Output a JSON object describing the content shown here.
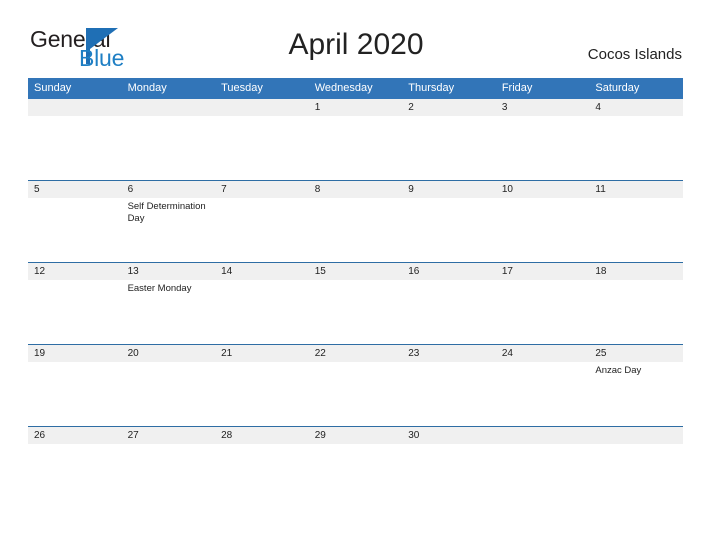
{
  "brand": {
    "name_part1": "General",
    "name_part2": "Blue",
    "accent_color": "#1f7fc4"
  },
  "header": {
    "title": "April 2020",
    "locale": "Cocos Islands"
  },
  "calendar": {
    "header_bg": "#3275b8",
    "daynum_band_bg": "#f0f0f0",
    "row_divider_color": "#2e6da4",
    "weekday_headers": [
      "Sunday",
      "Monday",
      "Tuesday",
      "Wednesday",
      "Thursday",
      "Friday",
      "Saturday"
    ],
    "weeks": [
      [
        {
          "day": "",
          "events": []
        },
        {
          "day": "",
          "events": []
        },
        {
          "day": "",
          "events": []
        },
        {
          "day": "1",
          "events": []
        },
        {
          "day": "2",
          "events": []
        },
        {
          "day": "3",
          "events": []
        },
        {
          "day": "4",
          "events": []
        }
      ],
      [
        {
          "day": "5",
          "events": []
        },
        {
          "day": "6",
          "events": [
            "Self Determination Day"
          ]
        },
        {
          "day": "7",
          "events": []
        },
        {
          "day": "8",
          "events": []
        },
        {
          "day": "9",
          "events": []
        },
        {
          "day": "10",
          "events": []
        },
        {
          "day": "11",
          "events": []
        }
      ],
      [
        {
          "day": "12",
          "events": []
        },
        {
          "day": "13",
          "events": [
            "Easter Monday"
          ]
        },
        {
          "day": "14",
          "events": []
        },
        {
          "day": "15",
          "events": []
        },
        {
          "day": "16",
          "events": []
        },
        {
          "day": "17",
          "events": []
        },
        {
          "day": "18",
          "events": []
        }
      ],
      [
        {
          "day": "19",
          "events": []
        },
        {
          "day": "20",
          "events": []
        },
        {
          "day": "21",
          "events": []
        },
        {
          "day": "22",
          "events": []
        },
        {
          "day": "23",
          "events": []
        },
        {
          "day": "24",
          "events": []
        },
        {
          "day": "25",
          "events": [
            "Anzac Day"
          ]
        }
      ],
      [
        {
          "day": "26",
          "events": []
        },
        {
          "day": "27",
          "events": []
        },
        {
          "day": "28",
          "events": []
        },
        {
          "day": "29",
          "events": []
        },
        {
          "day": "30",
          "events": []
        },
        {
          "day": "",
          "events": []
        },
        {
          "day": "",
          "events": []
        }
      ]
    ]
  }
}
